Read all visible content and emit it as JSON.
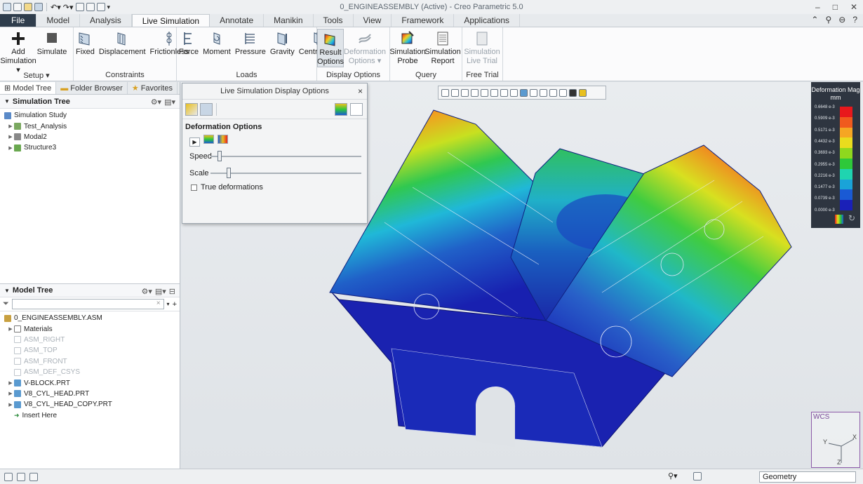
{
  "window": {
    "title": "0_ENGINEASSEMBLY (Active) - Creo Parametric 5.0",
    "controls": [
      "–",
      "□",
      "✕"
    ]
  },
  "tabs": [
    {
      "label": "File"
    },
    {
      "label": "Model"
    },
    {
      "label": "Analysis"
    },
    {
      "label": "Live Simulation"
    },
    {
      "label": "Annotate"
    },
    {
      "label": "Manikin"
    },
    {
      "label": "Tools"
    },
    {
      "label": "View"
    },
    {
      "label": "Framework"
    },
    {
      "label": "Applications"
    }
  ],
  "ribbon": {
    "groups": [
      {
        "title": "Setup ▾",
        "buttons": [
          "Add Simulation ▾",
          "Simulate"
        ]
      },
      {
        "title": "Constraints",
        "buttons": [
          "Fixed",
          "Displacement",
          "Frictionless"
        ]
      },
      {
        "title": "Loads",
        "buttons": [
          "Force",
          "Moment",
          "Pressure",
          "Gravity",
          "Centrifugal"
        ]
      },
      {
        "title": "Display Options",
        "buttons": [
          "Result Options",
          "Deformation Options ▾"
        ]
      },
      {
        "title": "Query",
        "buttons": [
          "Simulation Probe",
          "Simulation Report"
        ]
      },
      {
        "title": "Free Trial",
        "buttons": [
          "Simulation Live Trial"
        ]
      }
    ],
    "add_simulation_l1": "Add",
    "add_simulation_l2": "Simulation ▾",
    "result_l1": "Result",
    "result_l2": "Options",
    "deform_l1": "Deformation",
    "deform_l2": "Options ▾",
    "probe_l1": "Simulation",
    "probe_l2": "Probe",
    "report_l1": "Simulation",
    "report_l2": "Report",
    "trial_l1": "Simulation",
    "trial_l2": "Live Trial"
  },
  "navigator": {
    "tabs": [
      "Model Tree",
      "Folder Browser",
      "Favorites"
    ],
    "sim_tree_title": "Simulation Tree",
    "sim_tree": [
      "Simulation Study",
      "Test_Analysis",
      "Modal2",
      "Structure3"
    ],
    "model_tree_title": "Model Tree",
    "model_tree": [
      "0_ENGINEASSEMBLY.ASM",
      "Materials",
      "ASM_RIGHT",
      "ASM_TOP",
      "ASM_FRONT",
      "ASM_DEF_CSYS",
      "V-BLOCK.PRT",
      "V8_CYL_HEAD.PRT",
      "V8_CYL_HEAD_COPY.PRT",
      "Insert Here"
    ]
  },
  "dialog": {
    "title": "Live Simulation Display Options",
    "section": "Deformation Options",
    "speed_label": "Speed",
    "scale_label": "Scale",
    "true_deformations": "True deformations",
    "speed_value": 0.06,
    "scale_value": 0.12,
    "true_deformations_checked": false
  },
  "legend": {
    "title": "Deformation Mag",
    "unit": "mm",
    "values": [
      "0.6648 e-3",
      "0.5909 e-3",
      "0.5171 e-3",
      "0.4432 e-3",
      "0.3693 e-3",
      "0.2955 e-3",
      "0.2216 e-3",
      "0.1477 e-3",
      "0.0739 e-3",
      "0.0000 e-3"
    ],
    "colors": [
      "#e8181c",
      "#f05a1e",
      "#f5a623",
      "#e9dc1e",
      "#8fd81e",
      "#2ec83a",
      "#1fd4b0",
      "#1aa3d8",
      "#1a5ad4",
      "#1a20b8"
    ]
  },
  "wcs": {
    "label": "WCS",
    "axes": [
      "X",
      "Y",
      "Z"
    ]
  },
  "statusbar": {
    "selection_filter": "Geometry"
  },
  "icons": [
    "save-icon",
    "undo-icon",
    "redo-icon",
    "search-icon",
    "help-icon",
    "close-icon",
    "filter-icon"
  ]
}
